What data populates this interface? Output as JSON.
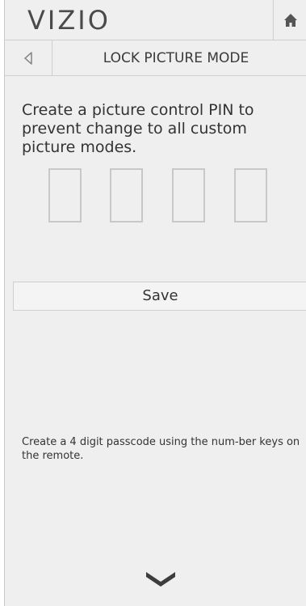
{
  "header": {
    "logo": "VIZIO",
    "home_icon": "home-icon"
  },
  "titlebar": {
    "back_icon": "back-arrow-icon",
    "title": "LOCK PICTURE MODE"
  },
  "content": {
    "description": "Create a picture control PIN to prevent change to all custom picture modes.",
    "pin_digits": [
      "",
      "",
      "",
      ""
    ],
    "save_label": "Save",
    "help_text": "Create a 4 digit passcode using the num-ber keys on the remote."
  },
  "footer": {
    "scroll_icon": "chevron-down-icon"
  },
  "colors": {
    "panel_bg": "#efefef",
    "border": "#cfcfcf",
    "text": "#333333"
  }
}
